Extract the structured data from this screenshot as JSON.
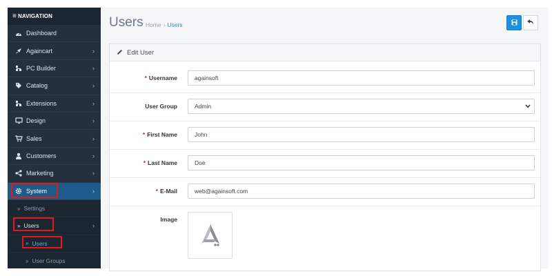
{
  "sidebar": {
    "header": "NAVIGATION",
    "items": [
      {
        "label": "Dashboard",
        "icon": "dashboard-icon",
        "has_children": false
      },
      {
        "label": "Againcart",
        "icon": "rocket-icon",
        "has_children": true
      },
      {
        "label": "PC Builder",
        "icon": "sitemap-icon",
        "has_children": true
      },
      {
        "label": "Catalog",
        "icon": "tag-icon",
        "has_children": true
      },
      {
        "label": "Extensions",
        "icon": "puzzle-icon",
        "has_children": true
      },
      {
        "label": "Design",
        "icon": "monitor-icon",
        "has_children": true
      },
      {
        "label": "Sales",
        "icon": "cart-icon",
        "has_children": true
      },
      {
        "label": "Customers",
        "icon": "user-icon",
        "has_children": true
      },
      {
        "label": "Marketing",
        "icon": "share-icon",
        "has_children": true
      },
      {
        "label": "System",
        "icon": "gear-icon",
        "has_children": true,
        "active": true
      }
    ],
    "system_children": [
      {
        "label": "Settings"
      },
      {
        "label": "Users",
        "has_children": true
      }
    ],
    "users_children": [
      {
        "label": "Users",
        "current": true
      },
      {
        "label": "User Groups"
      }
    ]
  },
  "header": {
    "title": "Users",
    "breadcrumb": [
      "Home",
      "Users"
    ],
    "save_icon": "floppy-disk-icon",
    "back_icon": "reply-icon"
  },
  "form": {
    "title": "Edit User",
    "fields": {
      "username": {
        "label": "Username",
        "required": true,
        "value": "againsoft"
      },
      "user_group": {
        "label": "User Group",
        "required": false,
        "value": "Admin"
      },
      "firstname": {
        "label": "First Name",
        "required": true,
        "value": "John"
      },
      "lastname": {
        "label": "Last Name",
        "required": true,
        "value": "Doe"
      },
      "email": {
        "label": "E-Mail",
        "required": true,
        "value": "web@againsoft.com"
      },
      "image": {
        "label": "Image"
      }
    }
  },
  "colors": {
    "sidebar_bg": "#24303c",
    "active_bg": "#1e5a8a",
    "primary": "#1e90e0",
    "highlight": "#e3191c",
    "link": "#3b8ed0"
  }
}
